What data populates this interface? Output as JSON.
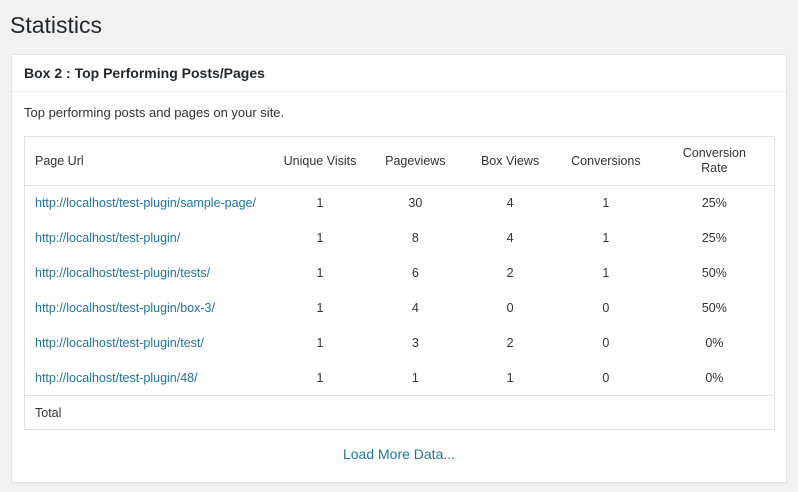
{
  "page": {
    "title": "Statistics"
  },
  "box": {
    "title": "Box 2 : Top Performing Posts/Pages",
    "description": "Top performing posts and pages on your site."
  },
  "table": {
    "headers": [
      "Page Url",
      "Unique Visits",
      "Pageviews",
      "Box Views",
      "Conversions",
      "Conversion Rate"
    ],
    "rows": [
      {
        "url": "http://localhost/test-plugin/sample-page/",
        "unique_visits": "1",
        "pageviews": "30",
        "box_views": "4",
        "conversions": "1",
        "conversion_rate": "25%"
      },
      {
        "url": "http://localhost/test-plugin/",
        "unique_visits": "1",
        "pageviews": "8",
        "box_views": "4",
        "conversions": "1",
        "conversion_rate": "25%"
      },
      {
        "url": "http://localhost/test-plugin/tests/",
        "unique_visits": "1",
        "pageviews": "6",
        "box_views": "2",
        "conversions": "1",
        "conversion_rate": "50%"
      },
      {
        "url": "http://localhost/test-plugin/box-3/",
        "unique_visits": "1",
        "pageviews": "4",
        "box_views": "0",
        "conversions": "0",
        "conversion_rate": "50%"
      },
      {
        "url": "http://localhost/test-plugin/test/",
        "unique_visits": "1",
        "pageviews": "3",
        "box_views": "2",
        "conversions": "0",
        "conversion_rate": "0%"
      },
      {
        "url": "http://localhost/test-plugin/48/",
        "unique_visits": "1",
        "pageviews": "1",
        "box_views": "1",
        "conversions": "0",
        "conversion_rate": "0%"
      }
    ],
    "footer": "Total"
  },
  "load_more": {
    "label": "Load More Data..."
  },
  "colors": {
    "link": "#21759b",
    "highlight_value": "#4a7a00"
  }
}
